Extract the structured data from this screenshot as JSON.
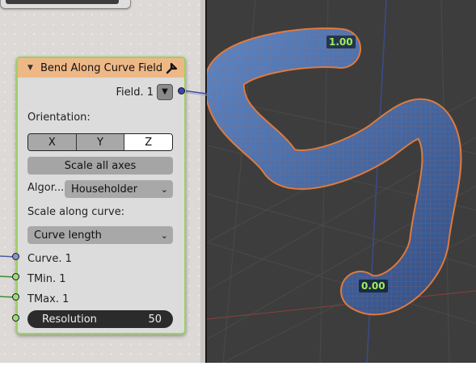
{
  "node": {
    "title": "Bend Along Curve Field",
    "output_label": "Field. 1",
    "orientation_label": "Orientation:",
    "orientation_options": [
      "X",
      "Y",
      "Z"
    ],
    "orientation_selected": "Z",
    "scale_all_axes": "Scale all axes",
    "algorithm_label": "Algor...",
    "algorithm_value": "Householder",
    "scale_along_label": "Scale along curve:",
    "scale_along_value": "Curve length",
    "inputs": {
      "curve": "Curve. 1",
      "tmin": "TMin. 1",
      "tmax": "TMax. 1"
    },
    "resolution_label": "Resolution",
    "resolution_value": "50"
  },
  "viewport": {
    "label_end": "1.00",
    "label_start": "0.00"
  },
  "colors": {
    "node_header": "#eeb886",
    "node_border": "#9bd25c",
    "mesh_fill": "#4a6fa8",
    "mesh_edge": "#e07a3c",
    "viewport_bg": "#3d3d3d",
    "label_text": "#9cf05a"
  },
  "icons": [
    "wrench-icon",
    "chevron-down-icon",
    "collapse-arrow-icon"
  ]
}
